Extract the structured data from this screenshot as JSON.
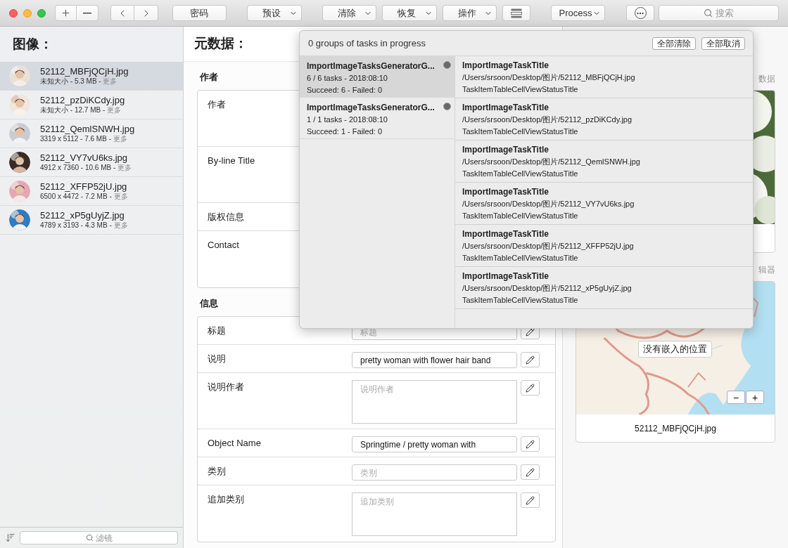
{
  "toolbar": {
    "items": [
      {
        "kind": "addremove"
      },
      {
        "kind": "navigate"
      },
      {
        "kind": "button",
        "label": "密码"
      },
      {
        "kind": "dropdown",
        "label": "预设"
      },
      {
        "kind": "dropdown",
        "label": "清除"
      },
      {
        "kind": "dropdown",
        "label": "恢复"
      },
      {
        "kind": "dropdown",
        "label": "操作"
      },
      {
        "kind": "tasks"
      },
      {
        "kind": "dropdown",
        "label": "Process"
      },
      {
        "kind": "more"
      }
    ],
    "search": {
      "placeholder": "搜索"
    }
  },
  "sidebar": {
    "title": "图像：",
    "items": [
      {
        "name": "52112_MBFjQCjH.jpg",
        "info": "未知大小 - 5.3 MB - ",
        "more": "更多",
        "selected": true
      },
      {
        "name": "52112_pzDiKCdy.jpg",
        "info": "未知大小 - 12.7 MB - ",
        "more": "更多",
        "selected": false
      },
      {
        "name": "52112_QemlSNWH.jpg",
        "info": "3319 x 5112 - 7.6 MB - ",
        "more": "更多",
        "selected": false
      },
      {
        "name": "52112_VY7vU6ks.jpg",
        "info": "4912 x 7360 - 10.6 MB - ",
        "more": "更多",
        "selected": false
      },
      {
        "name": "52112_XFFP52jU.jpg",
        "info": "6500 x 4472 - 7.2 MB - ",
        "more": "更多",
        "selected": false
      },
      {
        "name": "52112_xP5gUyjZ.jpg",
        "info": "4789 x 3193 - 4.3 MB - ",
        "more": "更多",
        "selected": false
      }
    ],
    "filter": {
      "placeholder": "滤镜"
    }
  },
  "metadata": {
    "title": "元数据：",
    "sections": [
      {
        "title": "作者",
        "rows": [
          {
            "label": "作者",
            "kind": "note"
          },
          {
            "label": "By-line Title",
            "kind": "note"
          },
          {
            "label": "版权信息",
            "kind": "line"
          },
          {
            "label": "Contact",
            "kind": "note"
          }
        ]
      },
      {
        "title": "信息",
        "rows": [
          {
            "label": "标题",
            "kind": "input",
            "placeholder": "标题"
          },
          {
            "label": "说明",
            "kind": "input",
            "value": "pretty woman with flower hair band"
          },
          {
            "label": "说明作者",
            "kind": "textarea",
            "placeholder": "说明作者"
          },
          {
            "label": "Object Name",
            "kind": "input",
            "value": "Springtime / pretty woman with"
          },
          {
            "label": "类别",
            "kind": "input",
            "placeholder": "类别"
          },
          {
            "label": "追加类别",
            "kind": "textarea",
            "placeholder": "追加类别"
          }
        ]
      }
    ]
  },
  "preview": {
    "photo_caption": "数据",
    "map_caption": "辑器",
    "map_tooltip": "没有嵌入的位置",
    "zoom_out": "−",
    "zoom_in": "+",
    "filename": "52112_MBFjQCjH.jpg"
  },
  "tasks_popover": {
    "title": "0 groups of tasks in progress",
    "buttons": [
      "全部清除",
      "全部取消"
    ],
    "groups": [
      {
        "title": "ImportImageTasksGeneratorG...",
        "progress": "6 / 6 tasks - 2018:08:10",
        "result": "Succeed: 6 - Failed: 0",
        "selected": true
      },
      {
        "title": "ImportImageTasksGeneratorG...",
        "progress": "1 / 1 tasks - 2018:08:10",
        "result": "Succeed: 1 - Failed: 0",
        "selected": false
      }
    ],
    "tasks": [
      {
        "title": "ImportImageTaskTitle",
        "path": "/Users/srsoon/Desktop/图片/52112_MBFjQCjH.jpg",
        "status": "TaskItemTableCellViewStatusTitle"
      },
      {
        "title": "ImportImageTaskTitle",
        "path": "/Users/srsoon/Desktop/图片/52112_pzDiKCdy.jpg",
        "status": "TaskItemTableCellViewStatusTitle"
      },
      {
        "title": "ImportImageTaskTitle",
        "path": "/Users/srsoon/Desktop/图片/52112_QemlSNWH.jpg",
        "status": "TaskItemTableCellViewStatusTitle"
      },
      {
        "title": "ImportImageTaskTitle",
        "path": "/Users/srsoon/Desktop/图片/52112_VY7vU6ks.jpg",
        "status": "TaskItemTableCellViewStatusTitle"
      },
      {
        "title": "ImportImageTaskTitle",
        "path": "/Users/srsoon/Desktop/图片/52112_XFFP52jU.jpg",
        "status": "TaskItemTableCellViewStatusTitle"
      },
      {
        "title": "ImportImageTaskTitle",
        "path": "/Users/srsoon/Desktop/图片/52112_xP5gUyjZ.jpg",
        "status": "TaskItemTableCellViewStatusTitle"
      }
    ]
  }
}
